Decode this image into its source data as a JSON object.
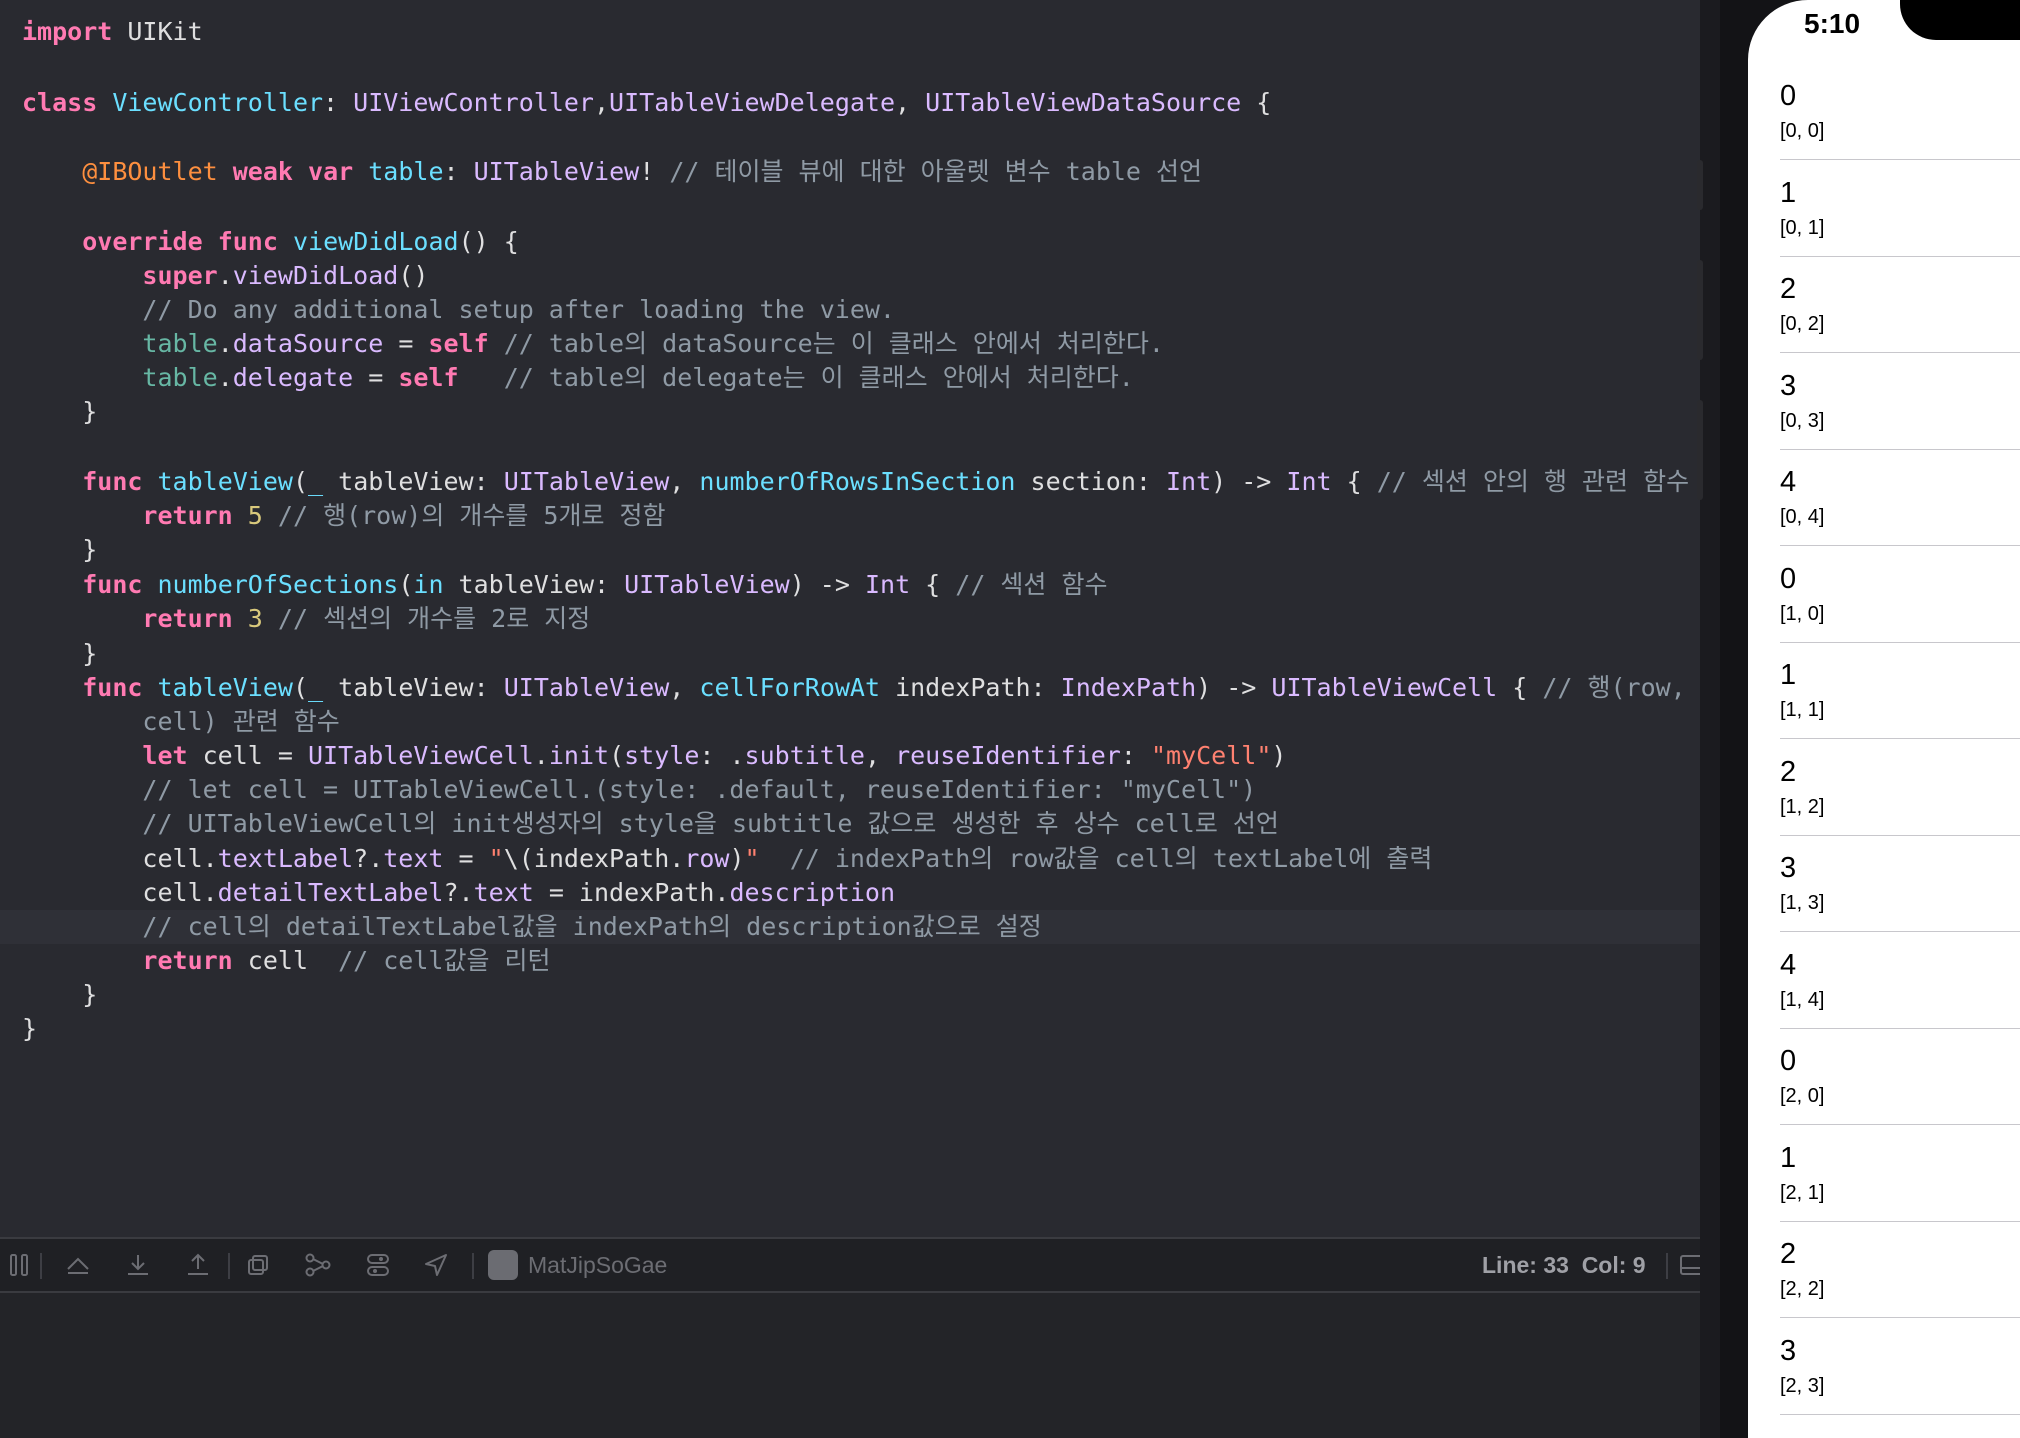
{
  "editor": {
    "lines": [
      [
        [
          "kw",
          "import"
        ],
        [
          "pl",
          " UIKit"
        ]
      ],
      [],
      [
        [
          "kw",
          "class"
        ],
        [
          "pl",
          " "
        ],
        [
          "dc",
          "ViewController"
        ],
        [
          "pl",
          ": "
        ],
        [
          "ty",
          "UIViewController"
        ],
        [
          "pl",
          ","
        ],
        [
          "ty",
          "UITableViewDelegate"
        ],
        [
          "pl",
          ", "
        ],
        [
          "ty",
          "UITableViewDataSource"
        ],
        [
          "pl",
          " {"
        ]
      ],
      [],
      [
        [
          "pl",
          "    "
        ],
        [
          "at",
          "@IBOutlet"
        ],
        [
          "pl",
          " "
        ],
        [
          "kw",
          "weak"
        ],
        [
          "pl",
          " "
        ],
        [
          "kw",
          "var"
        ],
        [
          "pl",
          " "
        ],
        [
          "dc",
          "table"
        ],
        [
          "pl",
          ": "
        ],
        [
          "ty",
          "UITableView"
        ],
        [
          "pl",
          "! "
        ],
        [
          "cm",
          "// 테이블 뷰에 대한 아울렛 변수 table 선언"
        ]
      ],
      [],
      [
        [
          "pl",
          "    "
        ],
        [
          "kw",
          "override"
        ],
        [
          "pl",
          " "
        ],
        [
          "kw",
          "func"
        ],
        [
          "pl",
          " "
        ],
        [
          "dc",
          "viewDidLoad"
        ],
        [
          "pl",
          "() {"
        ]
      ],
      [
        [
          "pl",
          "        "
        ],
        [
          "kw",
          "super"
        ],
        [
          "pl",
          "."
        ],
        [
          "ty",
          "viewDidLoad"
        ],
        [
          "pl",
          "()"
        ]
      ],
      [
        [
          "pl",
          "        "
        ],
        [
          "cm",
          "// Do any additional setup after loading the view."
        ]
      ],
      [
        [
          "pl",
          "        "
        ],
        [
          "fn",
          "table"
        ],
        [
          "pl",
          "."
        ],
        [
          "ty",
          "dataSource"
        ],
        [
          "pl",
          " = "
        ],
        [
          "kw",
          "self"
        ],
        [
          "pl",
          " "
        ],
        [
          "cm",
          "// table의 dataSource는 이 클래스 안에서 처리한다."
        ]
      ],
      [
        [
          "pl",
          "        "
        ],
        [
          "fn",
          "table"
        ],
        [
          "pl",
          "."
        ],
        [
          "ty",
          "delegate"
        ],
        [
          "pl",
          " = "
        ],
        [
          "kw",
          "self"
        ],
        [
          "pl",
          "   "
        ],
        [
          "cm",
          "// table의 delegate는 이 클래스 안에서 처리한다."
        ]
      ],
      [
        [
          "pl",
          "    }"
        ]
      ],
      [],
      [
        [
          "pl",
          "    "
        ],
        [
          "kw",
          "func"
        ],
        [
          "pl",
          " "
        ],
        [
          "dc",
          "tableView"
        ],
        [
          "pl",
          "("
        ],
        [
          "dc",
          "_"
        ],
        [
          "pl",
          " tableView: "
        ],
        [
          "ty",
          "UITableView"
        ],
        [
          "pl",
          ", "
        ],
        [
          "dc",
          "numberOfRowsInSection"
        ],
        [
          "pl",
          " section: "
        ],
        [
          "ty",
          "Int"
        ],
        [
          "pl",
          ") -> "
        ],
        [
          "ty",
          "Int"
        ],
        [
          "pl",
          " { "
        ],
        [
          "cm",
          "// 섹션 안의 행 관련 함수"
        ]
      ],
      [
        [
          "pl",
          "        "
        ],
        [
          "kw",
          "return"
        ],
        [
          "pl",
          " "
        ],
        [
          "nm",
          "5"
        ],
        [
          "pl",
          " "
        ],
        [
          "cm",
          "// 행(row)의 개수를 5개로 정함"
        ]
      ],
      [
        [
          "pl",
          "    }"
        ]
      ],
      [
        [
          "pl",
          "    "
        ],
        [
          "kw",
          "func"
        ],
        [
          "pl",
          " "
        ],
        [
          "dc",
          "numberOfSections"
        ],
        [
          "pl",
          "("
        ],
        [
          "dc",
          "in"
        ],
        [
          "pl",
          " tableView: "
        ],
        [
          "ty",
          "UITableView"
        ],
        [
          "pl",
          ") -> "
        ],
        [
          "ty",
          "Int"
        ],
        [
          "pl",
          " { "
        ],
        [
          "cm",
          "// 섹션 함수"
        ]
      ],
      [
        [
          "pl",
          "        "
        ],
        [
          "kw",
          "return"
        ],
        [
          "pl",
          " "
        ],
        [
          "nm",
          "3"
        ],
        [
          "pl",
          " "
        ],
        [
          "cm",
          "// 섹션의 개수를 2로 지정"
        ]
      ],
      [
        [
          "pl",
          "    }"
        ]
      ],
      [
        [
          "pl",
          "    "
        ],
        [
          "kw",
          "func"
        ],
        [
          "pl",
          " "
        ],
        [
          "dc",
          "tableView"
        ],
        [
          "pl",
          "("
        ],
        [
          "dc",
          "_"
        ],
        [
          "pl",
          " tableView: "
        ],
        [
          "ty",
          "UITableView"
        ],
        [
          "pl",
          ", "
        ],
        [
          "dc",
          "cellForRowAt"
        ],
        [
          "pl",
          " indexPath: "
        ],
        [
          "ty",
          "IndexPath"
        ],
        [
          "pl",
          ") -> "
        ],
        [
          "ty",
          "UITableViewCell"
        ],
        [
          "pl",
          " { "
        ],
        [
          "cm",
          "// 행(row,"
        ]
      ],
      [
        [
          "pl",
          "        "
        ],
        [
          "cm",
          "cell) 관련 함수"
        ]
      ],
      [
        [
          "pl",
          "        "
        ],
        [
          "kw",
          "let"
        ],
        [
          "pl",
          " cell = "
        ],
        [
          "ty",
          "UITableViewCell"
        ],
        [
          "pl",
          "."
        ],
        [
          "ty",
          "init"
        ],
        [
          "pl",
          "("
        ],
        [
          "ty",
          "style"
        ],
        [
          "pl",
          ": ."
        ],
        [
          "ty",
          "subtitle"
        ],
        [
          "pl",
          ", "
        ],
        [
          "ty",
          "reuseIdentifier"
        ],
        [
          "pl",
          ": "
        ],
        [
          "st",
          "\"myCell\""
        ],
        [
          "pl",
          ")"
        ]
      ],
      [
        [
          "pl",
          "        "
        ],
        [
          "cm",
          "// let cell = UITableViewCell.(style: .default, reuseIdentifier: \"myCell\")"
        ]
      ],
      [
        [
          "pl",
          "        "
        ],
        [
          "cm",
          "// UITableViewCell의 init생성자의 style을 subtitle 값으로 생성한 후 상수 cell로 선언"
        ]
      ],
      [
        [
          "pl",
          "        cell."
        ],
        [
          "ty",
          "textLabel"
        ],
        [
          "pl",
          "?."
        ],
        [
          "ty",
          "text"
        ],
        [
          "pl",
          " = "
        ],
        [
          "st",
          "\""
        ],
        [
          "pl",
          "\\(indexPath."
        ],
        [
          "ty",
          "row"
        ],
        [
          "pl",
          ")"
        ],
        [
          "st",
          "\""
        ],
        [
          "pl",
          "  "
        ],
        [
          "cm",
          "// indexPath의 row값을 cell의 textLabel에 출력"
        ]
      ],
      [
        [
          "pl",
          "        cell."
        ],
        [
          "ty",
          "detailTextLabel"
        ],
        [
          "pl",
          "?."
        ],
        [
          "ty",
          "text"
        ],
        [
          "pl",
          " = indexPath."
        ],
        [
          "ty",
          "description"
        ]
      ],
      [
        [
          "pl",
          "        "
        ],
        [
          "cm",
          "// cell의 detailTextLabel값을 indexPath의 description값으로 설정"
        ]
      ],
      [
        [
          "pl",
          "        "
        ],
        [
          "kw",
          "return"
        ],
        [
          "pl",
          " cell  "
        ],
        [
          "cm",
          "// cell값을 리턴"
        ]
      ],
      [
        [
          "pl",
          "    }"
        ]
      ],
      [
        [
          "pl",
          "}"
        ]
      ]
    ]
  },
  "toolbar": {
    "icons": [
      "hide-debug-area-icon",
      "continue-icon",
      "step-over-icon",
      "step-into-icon",
      "step-out-icon",
      "view-hierarchy-icon",
      "memory-graph-icon",
      "environment-overrides-icon",
      "location-icon"
    ],
    "scheme_name": "MatJipSoGae",
    "line_col": "Line: 33  Col: 9"
  },
  "simulator": {
    "time": "5:10",
    "rows": [
      {
        "title": "0",
        "detail": "[0, 0]"
      },
      {
        "title": "1",
        "detail": "[0, 1]"
      },
      {
        "title": "2",
        "detail": "[0, 2]"
      },
      {
        "title": "3",
        "detail": "[0, 3]"
      },
      {
        "title": "4",
        "detail": "[0, 4]"
      },
      {
        "title": "0",
        "detail": "[1, 0]"
      },
      {
        "title": "1",
        "detail": "[1, 1]"
      },
      {
        "title": "2",
        "detail": "[1, 2]"
      },
      {
        "title": "3",
        "detail": "[1, 3]"
      },
      {
        "title": "4",
        "detail": "[1, 4]"
      },
      {
        "title": "0",
        "detail": "[2, 0]"
      },
      {
        "title": "1",
        "detail": "[2, 1]"
      },
      {
        "title": "2",
        "detail": "[2, 2]"
      },
      {
        "title": "3",
        "detail": "[2, 3]"
      }
    ]
  }
}
